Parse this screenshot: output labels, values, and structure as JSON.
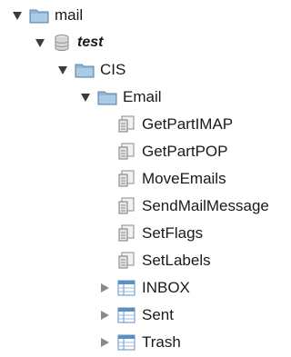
{
  "tree": {
    "root": {
      "label": "mail",
      "icon": "folder-icon",
      "state": "expanded"
    },
    "database": {
      "label": "test",
      "icon": "database-icon",
      "state": "expanded"
    },
    "folder_cis": {
      "label": "CIS",
      "icon": "folder-icon",
      "state": "expanded"
    },
    "folder_email": {
      "label": "Email",
      "icon": "folder-icon",
      "state": "expanded"
    },
    "procedures": [
      {
        "label": "GetPartIMAP",
        "icon": "stored-procedure-icon"
      },
      {
        "label": "GetPartPOP",
        "icon": "stored-procedure-icon"
      },
      {
        "label": "MoveEmails",
        "icon": "stored-procedure-icon"
      },
      {
        "label": "SendMailMessage",
        "icon": "stored-procedure-icon"
      },
      {
        "label": "SetFlags",
        "icon": "stored-procedure-icon"
      },
      {
        "label": "SetLabels",
        "icon": "stored-procedure-icon"
      }
    ],
    "tables": [
      {
        "label": "INBOX",
        "icon": "table-icon",
        "state": "collapsed"
      },
      {
        "label": "Sent",
        "icon": "table-icon",
        "state": "collapsed"
      },
      {
        "label": "Trash",
        "icon": "table-icon",
        "state": "collapsed"
      }
    ]
  },
  "colors": {
    "folder_blue": "#8fb7d8",
    "table_blue": "#5d8fc7",
    "text": "#1a1a1a"
  }
}
